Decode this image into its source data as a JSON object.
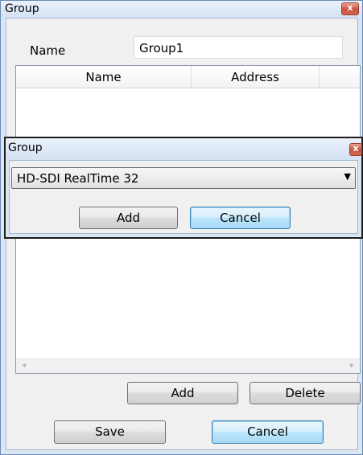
{
  "main_window": {
    "title": "Group",
    "close_glyph": "x",
    "name_label": "Name",
    "name_value": "Group1",
    "columns": [
      "Name",
      "Address"
    ],
    "scroll_left": "◂",
    "scroll_right": "▸",
    "add_label": "Add",
    "delete_label": "Delete",
    "save_label": "Save",
    "cancel_label": "Cancel"
  },
  "add_dialog": {
    "title": "Group",
    "close_glyph": "x",
    "selected_option": "HD-SDI RealTime 32",
    "dropdown_arrow": "▼",
    "add_label": "Add",
    "cancel_label": "Cancel"
  }
}
